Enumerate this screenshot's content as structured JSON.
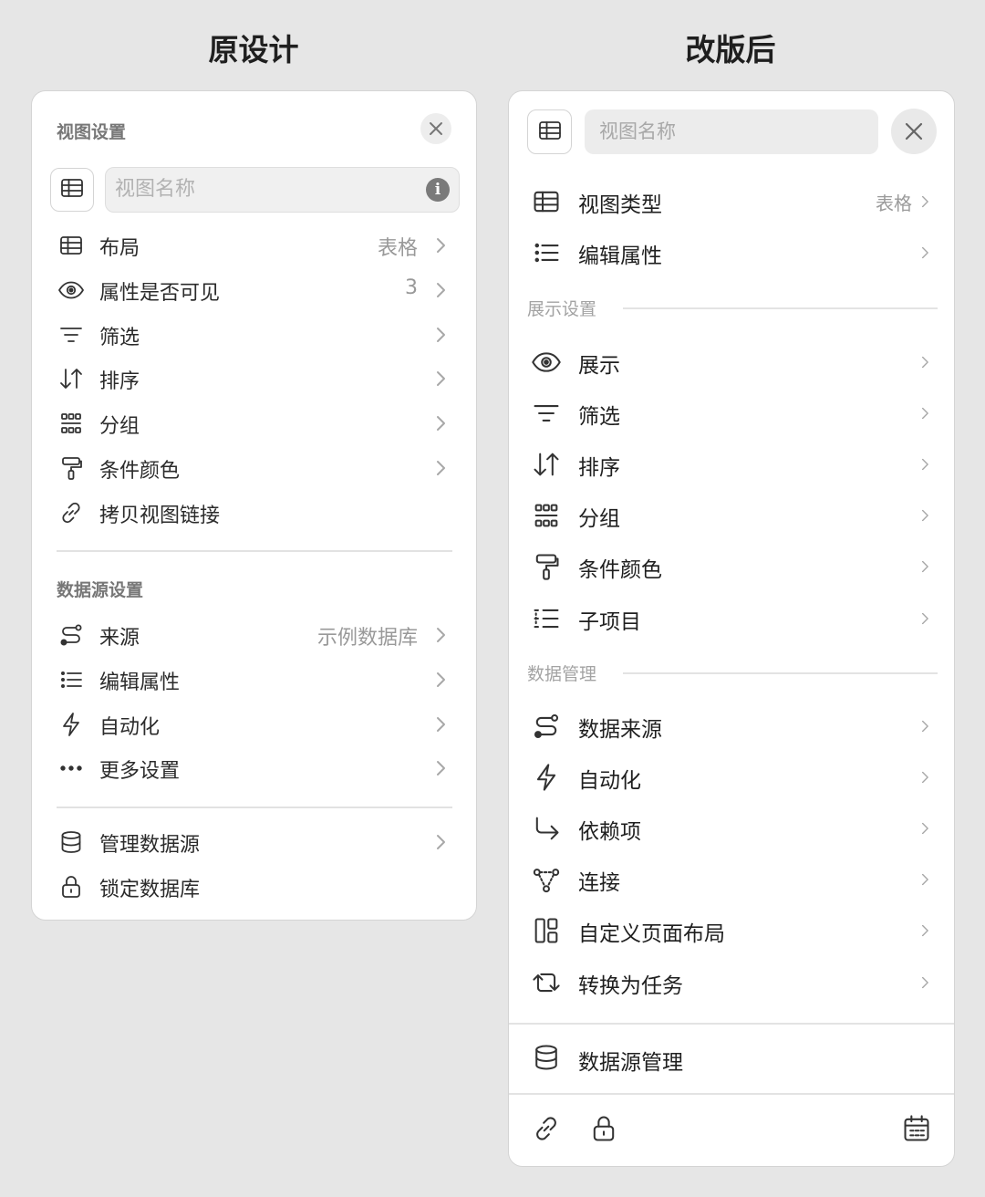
{
  "titles": {
    "left": "原设计",
    "right": "改版后"
  },
  "left": {
    "header": "视图设置",
    "name_placeholder": "视图名称",
    "info_glyph": "i",
    "rows1": [
      {
        "icon": "table-icon",
        "label": "布局",
        "value": "表格"
      },
      {
        "icon": "eye-icon",
        "label": "属性是否可见",
        "value": "3"
      },
      {
        "icon": "filter-icon",
        "label": "筛选",
        "value": ""
      },
      {
        "icon": "sort-icon",
        "label": "排序",
        "value": ""
      },
      {
        "icon": "group-icon",
        "label": "分组",
        "value": ""
      },
      {
        "icon": "paint-roller-icon",
        "label": "条件颜色",
        "value": ""
      },
      {
        "icon": "link-icon",
        "label": "拷贝视图链接",
        "value": ""
      }
    ],
    "section2": "数据源设置",
    "rows2": [
      {
        "icon": "source-icon",
        "label": "来源",
        "value": "示例数据库"
      },
      {
        "icon": "list-icon",
        "label": "编辑属性",
        "value": ""
      },
      {
        "icon": "bolt-icon",
        "label": "自动化",
        "value": ""
      },
      {
        "icon": "more-icon",
        "label": "更多设置",
        "value": ""
      }
    ],
    "rows3": [
      {
        "icon": "database-icon",
        "label": "管理数据源",
        "value": ""
      },
      {
        "icon": "lock-icon",
        "label": "锁定数据库",
        "value": ""
      }
    ]
  },
  "right": {
    "name_placeholder": "视图名称",
    "rows1": [
      {
        "icon": "table-icon",
        "label": "视图类型",
        "value": "表格"
      },
      {
        "icon": "list-icon",
        "label": "编辑属性",
        "value": ""
      }
    ],
    "section_display": "展示设置",
    "rows2": [
      {
        "icon": "eye-icon",
        "label": "展示"
      },
      {
        "icon": "filter-icon",
        "label": "筛选"
      },
      {
        "icon": "sort-icon",
        "label": "排序"
      },
      {
        "icon": "group-icon",
        "label": "分组"
      },
      {
        "icon": "paint-roller-icon",
        "label": "条件颜色"
      },
      {
        "icon": "subitems-icon",
        "label": "子项目"
      }
    ],
    "section_data": "数据管理",
    "rows3": [
      {
        "icon": "source-icon",
        "label": "数据来源"
      },
      {
        "icon": "bolt-icon",
        "label": "自动化"
      },
      {
        "icon": "dependency-icon",
        "label": "依赖项"
      },
      {
        "icon": "connect-icon",
        "label": "连接"
      },
      {
        "icon": "layout-icon",
        "label": "自定义页面布局"
      },
      {
        "icon": "convert-icon",
        "label": "转换为任务"
      }
    ],
    "manage_label": "数据源管理",
    "bottom_icons": [
      "link-icon",
      "lock-icon",
      "calendar-icon"
    ]
  }
}
